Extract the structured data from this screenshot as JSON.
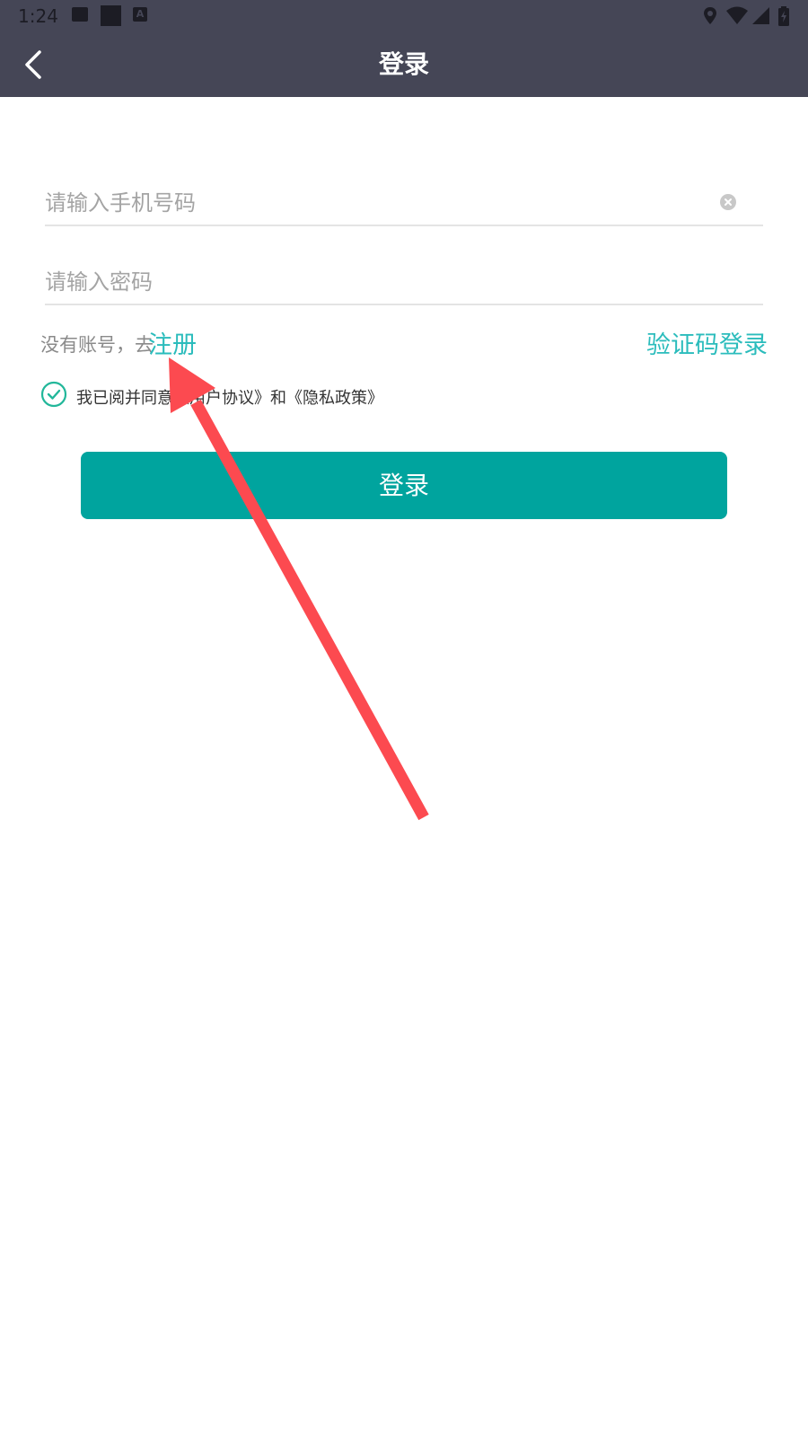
{
  "status_bar": {
    "time": "1:24",
    "icons": [
      "image-icon",
      "square-icon",
      "a-icon",
      "location-icon",
      "wifi-icon",
      "signal-icon",
      "battery-icon"
    ]
  },
  "app_bar": {
    "title": "登录",
    "back_icon": "chevron-left-icon"
  },
  "form": {
    "phone_placeholder": "请输入手机号码",
    "phone_value": "",
    "password_placeholder": "请输入密码",
    "password_value": "",
    "register_prefix": "没有账号，去",
    "register_link": "注册",
    "code_login_link": "验证码登录",
    "agreement_text": "我已阅并同意《用户协议》和《隐私政策》",
    "agreement_checked": true,
    "login_button": "登录"
  },
  "colors": {
    "app_bar": "#454656",
    "accent": "#2bbcbc",
    "button": "#00a49e",
    "annotation_arrow": "#fc4a50"
  }
}
